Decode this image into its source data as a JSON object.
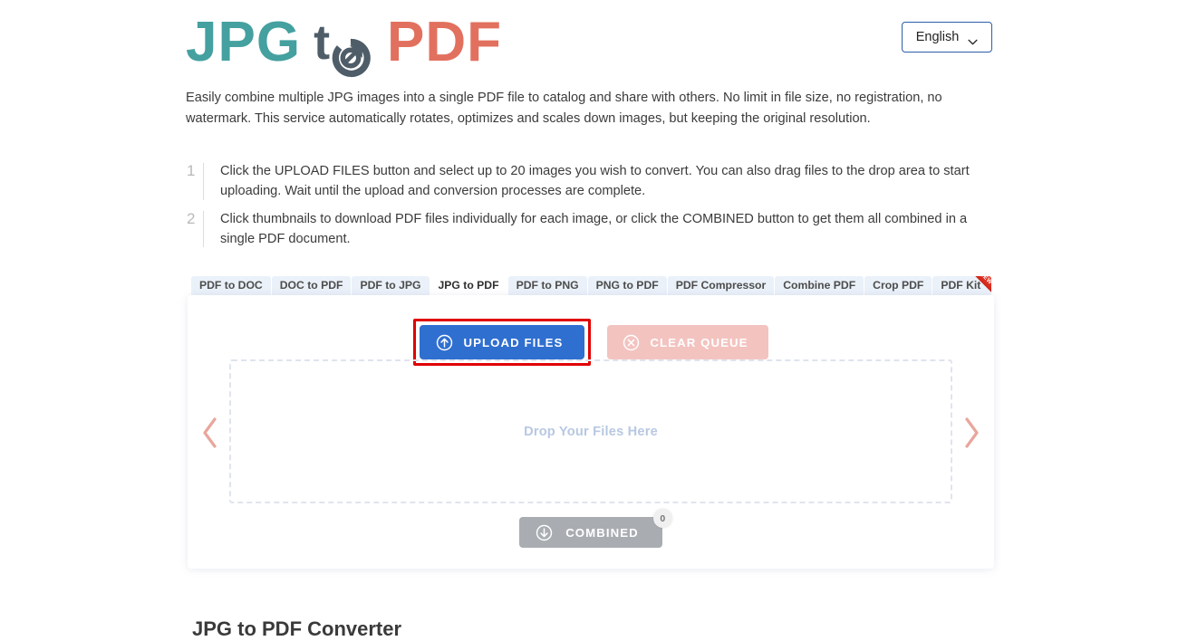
{
  "header": {
    "logo": {
      "part1": "JPG",
      "part2": "t",
      "refresh_icon": "refresh-circular-arrow-icon",
      "part3": "PDF"
    },
    "language_selector": {
      "value": "English",
      "caret_icon": "chevron-down-icon"
    }
  },
  "description": "Easily combine multiple JPG images into a single PDF file to catalog and share with others. No limit in file size, no registration, no watermark. This service automatically rotates, optimizes and scales down images, but keeping the original resolution.",
  "steps": [
    {
      "number": "1",
      "text": "Click the UPLOAD FILES button and select up to 20 images you wish to convert. You can also drag files to the drop area to start uploading. Wait until the upload and conversion processes are complete."
    },
    {
      "number": "2",
      "text": "Click thumbnails to download PDF files individually for each image, or click the COMBINED button to get them all combined in a single PDF document."
    }
  ],
  "tabs": [
    {
      "label": "PDF to DOC",
      "active": false
    },
    {
      "label": "DOC to PDF",
      "active": false
    },
    {
      "label": "PDF to JPG",
      "active": false
    },
    {
      "label": "JPG to PDF",
      "active": true
    },
    {
      "label": "PDF to PNG",
      "active": false
    },
    {
      "label": "PNG to PDF",
      "active": false
    },
    {
      "label": "PDF Compressor",
      "active": false
    },
    {
      "label": "Combine PDF",
      "active": false
    },
    {
      "label": "Crop PDF",
      "active": false
    }
  ],
  "tab_kit": {
    "label": "PDF Kit",
    "ribbon": "NEW"
  },
  "card": {
    "upload_button": {
      "label": "UPLOAD FILES",
      "icon": "upload-circle-arrow-icon"
    },
    "clear_button": {
      "label": "CLEAR QUEUE",
      "icon": "close-circle-icon"
    },
    "dropzone": {
      "label": "Drop Your Files Here"
    },
    "prev_arrow_icon": "chevron-left-icon",
    "next_arrow_icon": "chevron-right-icon",
    "combined_button": {
      "label": "COMBINED",
      "icon": "download-circle-arrow-icon",
      "badge": "0"
    }
  },
  "bottom_heading": "JPG to PDF Converter",
  "colors": {
    "logo_teal": "#45a0a0",
    "logo_slate": "#4e5d68",
    "logo_coral": "#e2705e",
    "upload_blue": "#2f6fd0",
    "clear_pink": "#f3c3c0",
    "combined_gray": "#a9adb1",
    "highlight_red": "#e00000",
    "tab_bg": "#eaf1f9",
    "dropzone_text": "#b8c8e2",
    "arrow_color": "#e8a69c"
  }
}
